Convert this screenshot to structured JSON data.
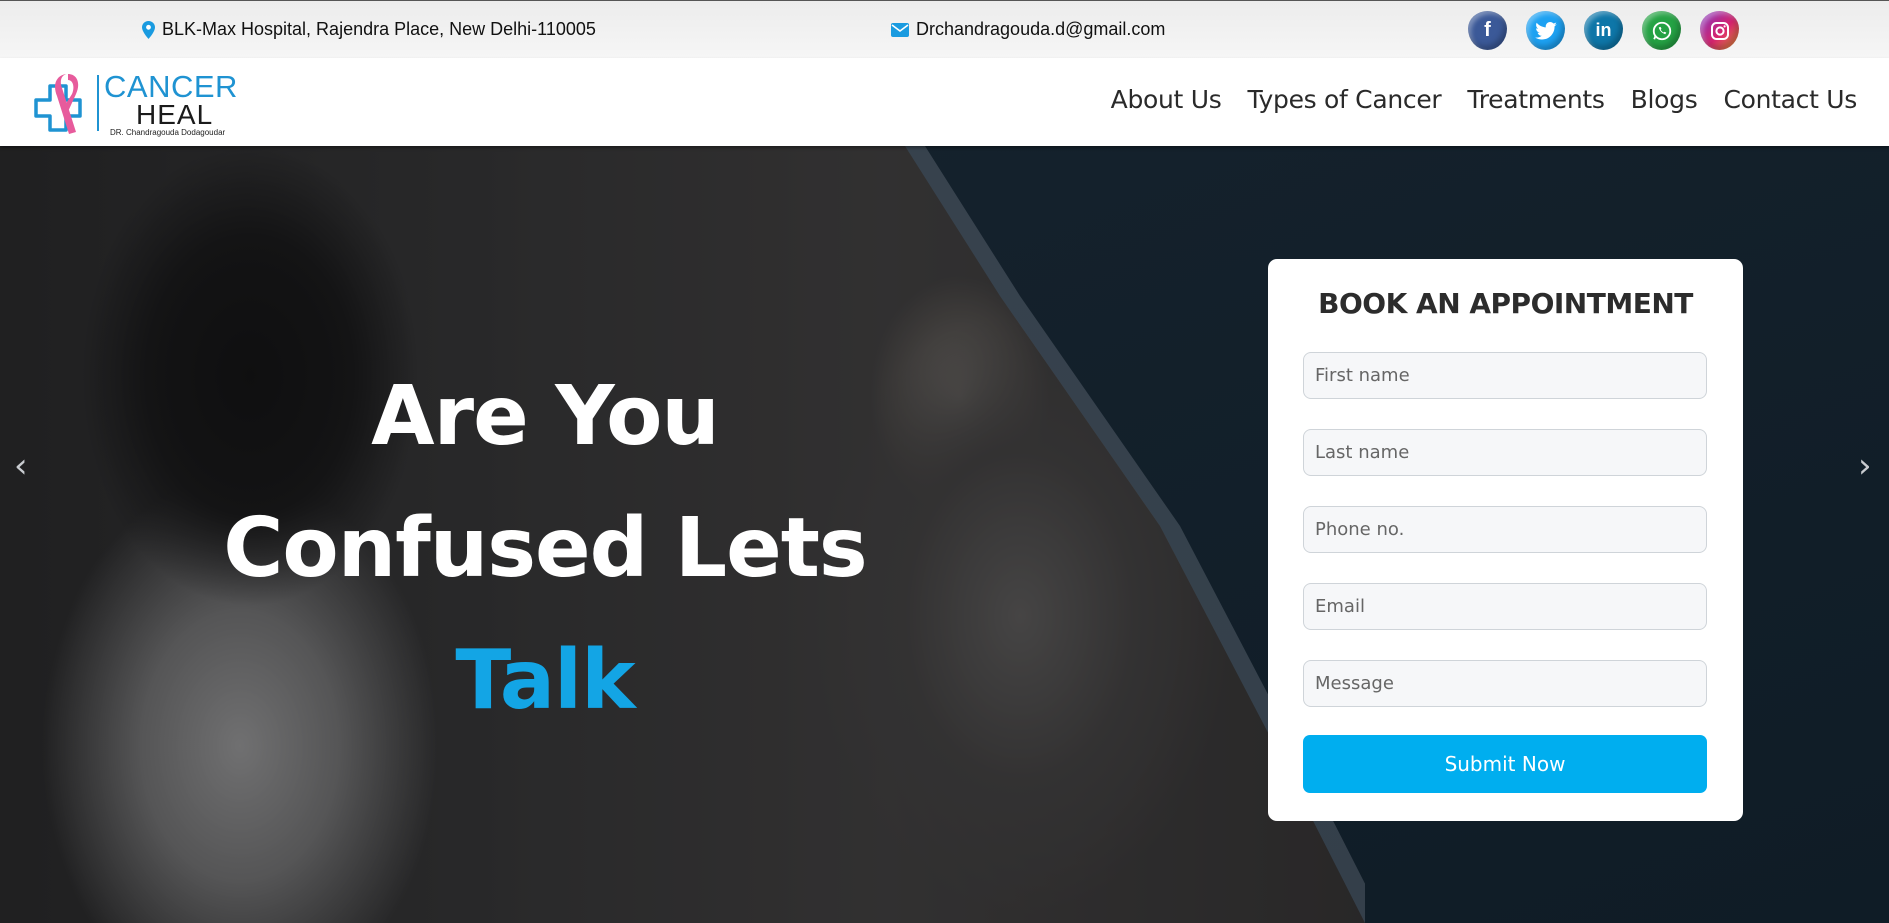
{
  "topbar": {
    "address": "BLK-Max Hospital, Rajendra Place, New Delhi-110005",
    "email": "Drchandragouda.d@gmail.com",
    "social": [
      {
        "name": "facebook",
        "glyph": "f"
      },
      {
        "name": "twitter",
        "glyph": "🐦"
      },
      {
        "name": "linkedin",
        "glyph": "in"
      },
      {
        "name": "whatsapp",
        "glyph": "✆"
      },
      {
        "name": "instagram",
        "glyph": "◎"
      }
    ]
  },
  "logo": {
    "line1": "CANCER",
    "line2": "HEAL",
    "tagline": "DR. Chandragouda Dodagoudar"
  },
  "nav": [
    "About Us",
    "Types of Cancer",
    "Treatments",
    "Blogs",
    "Contact Us"
  ],
  "hero": {
    "line1": "Are You",
    "line2": "Confused Lets",
    "line3": "Talk",
    "prev_arrow": "‹",
    "next_arrow": "›"
  },
  "form": {
    "title": "BOOK AN APPOINTMENT",
    "first_name_placeholder": "First name",
    "last_name_placeholder": "Last name",
    "phone_placeholder": "Phone no.",
    "email_placeholder": "Email",
    "message_placeholder": "Message",
    "submit_label": "Submit Now"
  },
  "colors": {
    "accent": "#00aeef",
    "brand_blue": "#1f93d2",
    "ribbon_pink": "#e75b9c"
  }
}
